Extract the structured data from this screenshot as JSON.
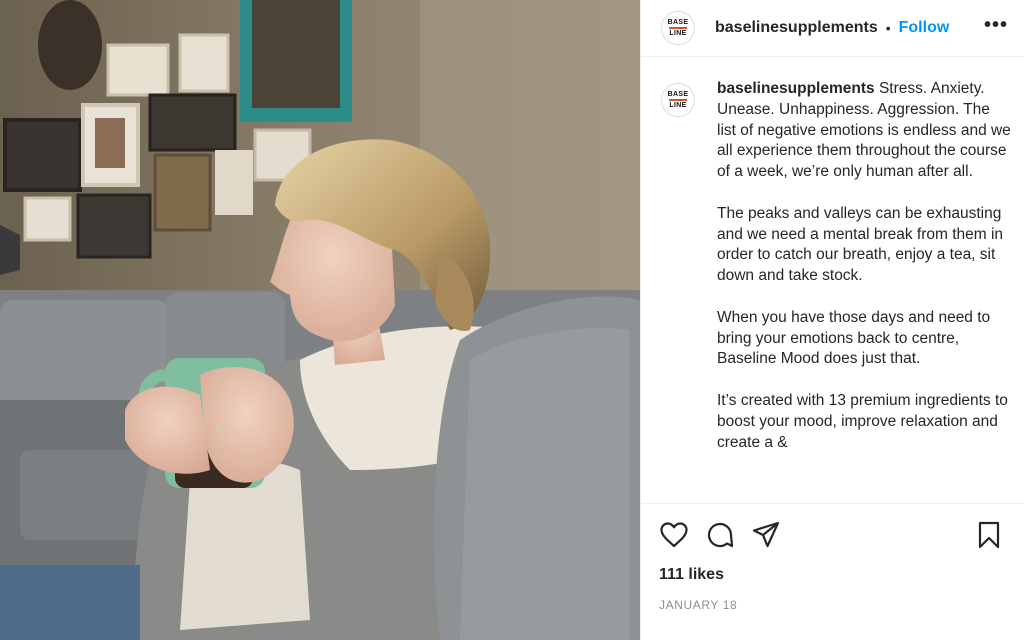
{
  "post": {
    "photo_icon": "woman-holding-mug-photo",
    "header": {
      "logo_text_top": "BASE",
      "logo_text_bottom": "LINE",
      "username": "baselinesupplements",
      "separator": "•",
      "follow_label": "Follow",
      "more_icon": "more-horizontal-icon",
      "more_label": "•••"
    },
    "caption": {
      "username": "baselinesupplements",
      "text": " Stress. Anxiety. Unease. Unhappiness. Aggression. The list of negative emotions is endless and we all experience them throughout the course of a week, we’re only human after all.\n\nThe peaks and valleys can be exhausting and we need a mental break from them in order to catch our breath, enjoy a tea, sit down and take stock.\n\nWhen you have those days and need to bring your emotions back to centre, Baseline Mood does just that.\n\nIt’s created with 13 premium ingredients to boost your mood, improve relaxation and create a &"
    },
    "actions": {
      "like_icon": "heart-icon",
      "comment_icon": "comment-icon",
      "share_icon": "share-icon",
      "save_icon": "bookmark-icon"
    },
    "likes": "111 likes",
    "date": "JANUARY 18"
  },
  "colors": {
    "accent": "#0095f6",
    "text": "#262626",
    "muted": "#8e8e8e",
    "border": "#efefef",
    "logo_bar": "#c85a2c"
  }
}
